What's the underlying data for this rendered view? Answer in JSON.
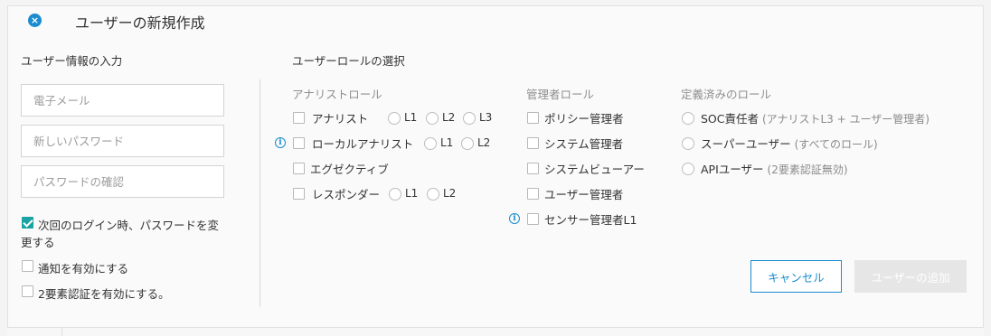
{
  "dialog": {
    "title": "ユーザーの新規作成"
  },
  "user_info": {
    "heading": "ユーザー情報の入力",
    "email_placeholder": "電子メール",
    "password_placeholder": "新しいパスワード",
    "confirm_placeholder": "パスワードの確認",
    "change_pw_line1": "次回のログイン時、パスワードを変",
    "change_pw_line2": "更する",
    "notify_label": "通知を有効にする",
    "twofa_label": "2要素認証を有効にする。"
  },
  "roles": {
    "heading": "ユーザーロールの選択",
    "analyst": {
      "heading": "アナリストロール",
      "items": [
        {
          "label": "アナリスト",
          "levels": [
            "L1",
            "L2",
            "L3"
          ]
        },
        {
          "label": "ローカルアナリスト",
          "levels": [
            "L1",
            "L2"
          ]
        },
        {
          "label": "エグゼクティブ",
          "levels": []
        },
        {
          "label": "レスポンダー",
          "levels": [
            "L1",
            "L2"
          ]
        }
      ]
    },
    "admin": {
      "heading": "管理者ロール",
      "items": [
        "ポリシー管理者",
        "システム管理者",
        "システムビューアー",
        "ユーザー管理者",
        "センサー管理者L1"
      ]
    },
    "predefined": {
      "heading": "定義済みのロール",
      "items": [
        {
          "label": "SOC責任者",
          "sub": "(アナリストL3 + ユーザー管理者)"
        },
        {
          "label": "スーパーユーザー",
          "sub": "(すべてのロール)"
        },
        {
          "label": "APIユーザー",
          "sub": "(2要素認証無効)"
        }
      ]
    }
  },
  "buttons": {
    "cancel": "キャンセル",
    "add": "ユーザーの追加"
  },
  "colors": {
    "accent": "#1a8ccf",
    "check": "#19a3a3",
    "disabled": "#e6e6e6"
  }
}
